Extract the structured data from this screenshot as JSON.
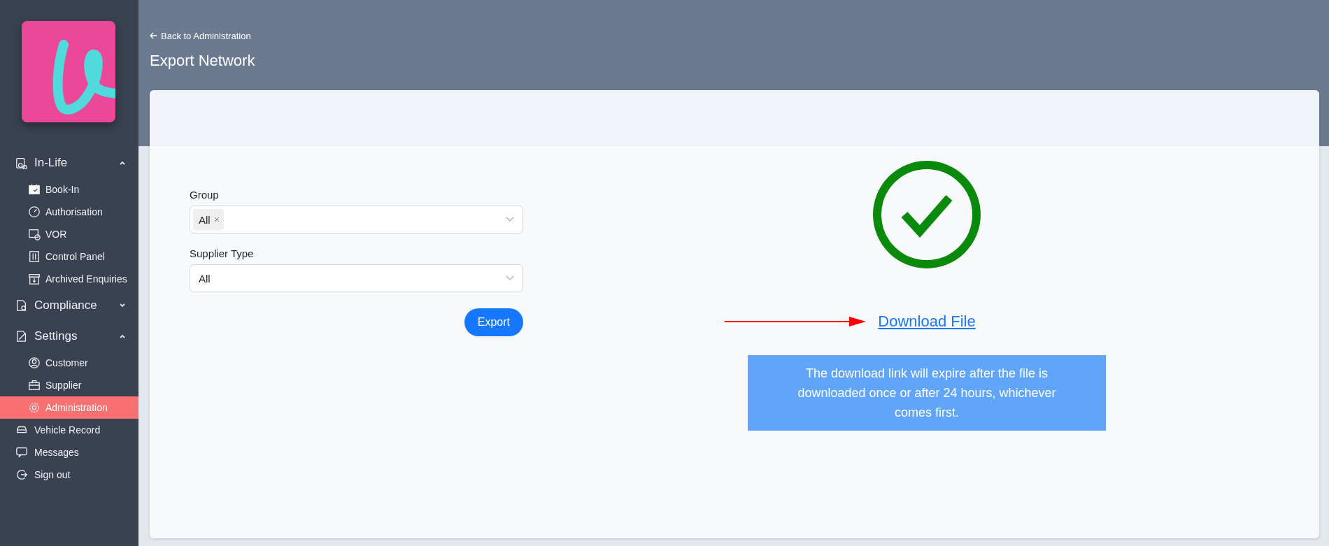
{
  "sidebar": {
    "items": [
      {
        "label": "In-Life",
        "expanded": true,
        "children": [
          {
            "label": "Book-In",
            "selected": false
          },
          {
            "label": "Authorisation",
            "selected": false
          },
          {
            "label": "VOR",
            "selected": false
          },
          {
            "label": "Control Panel",
            "selected": false
          },
          {
            "label": "Archived Enquiries",
            "selected": false
          }
        ]
      },
      {
        "label": "Compliance",
        "expanded": false
      },
      {
        "label": "Settings",
        "expanded": true,
        "children": [
          {
            "label": "Customer",
            "selected": false
          },
          {
            "label": "Supplier",
            "selected": false
          },
          {
            "label": "Administration",
            "selected": true
          }
        ]
      },
      {
        "label": "Vehicle Record",
        "selected": false
      },
      {
        "label": "Messages",
        "selected": false
      },
      {
        "label": "Sign out",
        "selected": false
      }
    ]
  },
  "header": {
    "back_link": "Back to Administration",
    "title": "Export Network"
  },
  "form": {
    "fields": [
      {
        "label": "Group",
        "kind": "tags",
        "tags": [
          "All"
        ]
      },
      {
        "label": "Supplier Type",
        "kind": "select",
        "value": "All"
      }
    ],
    "button": "Export"
  },
  "result": {
    "link": "Download File",
    "note": "The download link will expire after the file is downloaded once or after 24 hours, whichever comes first."
  }
}
